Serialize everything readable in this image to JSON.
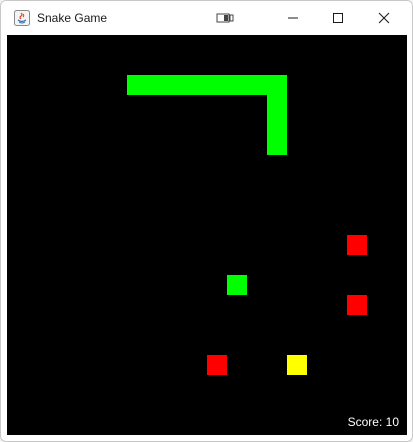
{
  "window": {
    "title": "Snake Game",
    "controls": {
      "snap": "snap-layout-icon",
      "minimize": "minimize-icon",
      "maximize": "maximize-icon",
      "close": "close-icon"
    }
  },
  "game": {
    "score_label": "Score: 10",
    "score": 10,
    "colors": {
      "background": "#000000",
      "snake": "#00ff00",
      "food": "#ff0000",
      "bonus": "#ffff00",
      "score_text": "#ffffff"
    }
  }
}
